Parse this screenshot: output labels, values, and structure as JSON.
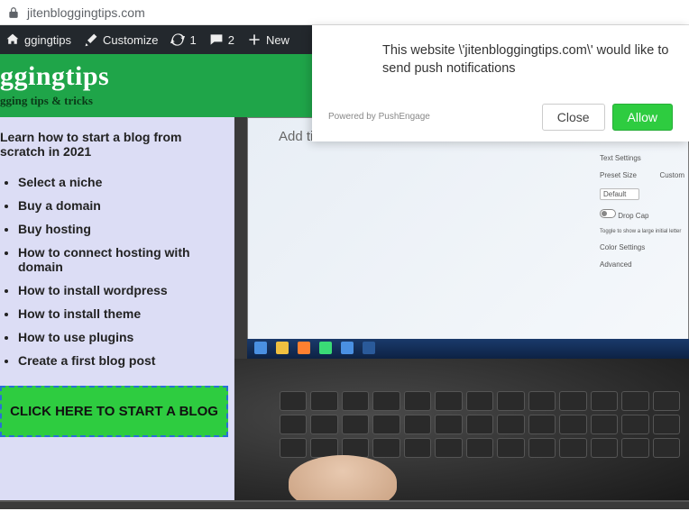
{
  "url": "jitenbloggingtips.com",
  "adminbar": {
    "site": "ggingtips",
    "customize": "Customize",
    "updates": "1",
    "comments": "2",
    "new": "New"
  },
  "header": {
    "title": "ggingtips",
    "tagline": "gging tips & tricks"
  },
  "sidebar": {
    "heading": "Learn how to start a blog from scratch in 2021",
    "items": [
      "Select a niche",
      "Buy a domain",
      "Buy hosting",
      "How to connect hosting with domain",
      "How to install wordpress",
      "How to install theme",
      "How to use plugins",
      "Create a first blog post"
    ],
    "cta": "CLICK HERE TO START A BLOG"
  },
  "editor": {
    "placeholder": "Add title",
    "panel": {
      "section1": "Text Settings",
      "preset_label": "Preset Size",
      "preset_value": "Default",
      "custom": "Custom",
      "dropcap": "Drop Cap",
      "dropcap_hint": "Toggle to show a large initial letter",
      "color": "Color Settings",
      "advanced": "Advanced"
    }
  },
  "notification": {
    "message": "This website \\'jitenbloggingtips.com\\' would like to send push notifications",
    "powered": "Powered by PushEngage",
    "close": "Close",
    "allow": "Allow"
  }
}
